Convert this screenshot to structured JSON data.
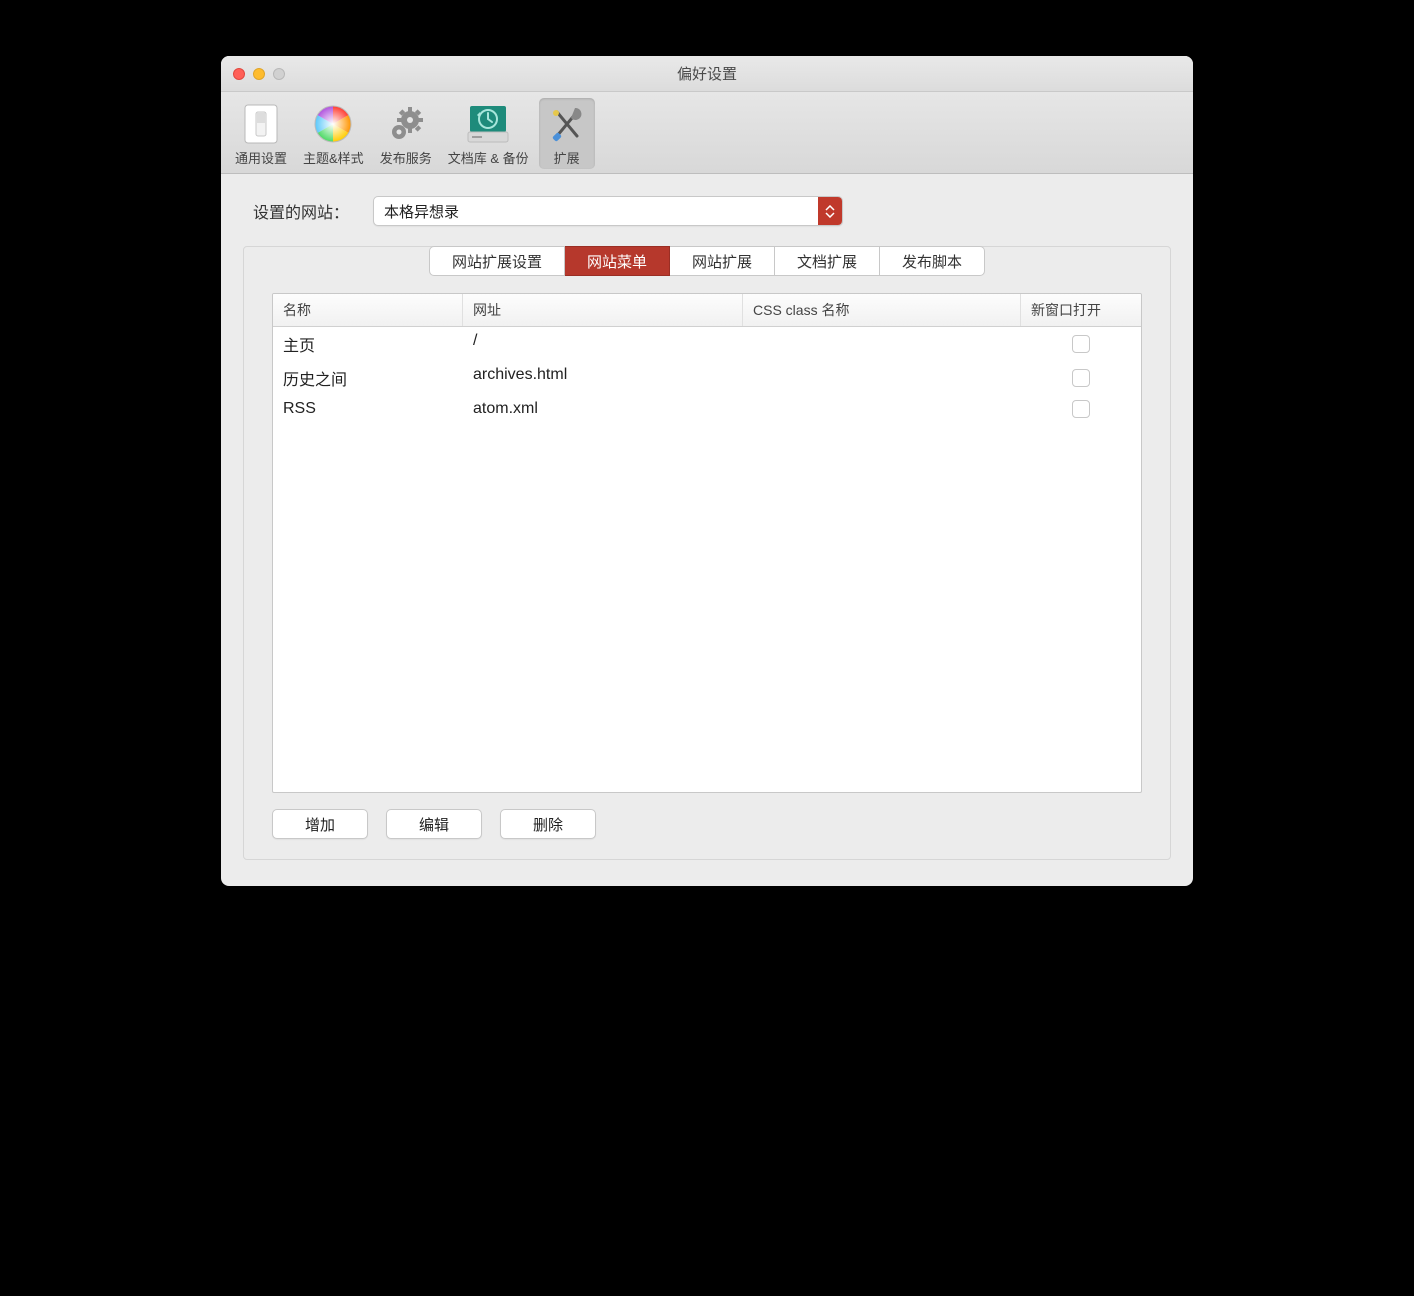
{
  "window": {
    "title": "偏好设置"
  },
  "toolbar": {
    "items": [
      {
        "id": "general",
        "label": "通用设置"
      },
      {
        "id": "theme",
        "label": "主题&样式"
      },
      {
        "id": "publish",
        "label": "发布服务"
      },
      {
        "id": "backup",
        "label": "文档库 & 备份"
      },
      {
        "id": "ext",
        "label": "扩展"
      }
    ],
    "active": "ext"
  },
  "site_select": {
    "label": "设置的网站：",
    "value": "本格异想录"
  },
  "tabs": {
    "items": [
      {
        "id": "ext-settings",
        "label": "网站扩展设置"
      },
      {
        "id": "menu",
        "label": "网站菜单"
      },
      {
        "id": "site-ext",
        "label": "网站扩展"
      },
      {
        "id": "doc-ext",
        "label": "文档扩展"
      },
      {
        "id": "script",
        "label": "发布脚本"
      }
    ],
    "active": "menu"
  },
  "table": {
    "headers": {
      "name": "名称",
      "url": "网址",
      "css": "CSS class 名称",
      "newwin": "新窗口打开"
    },
    "rows": [
      {
        "name": "主页",
        "url": "/",
        "css": "",
        "newwin": false
      },
      {
        "name": "历史之间",
        "url": "archives.html",
        "css": "",
        "newwin": false
      },
      {
        "name": "RSS",
        "url": "atom.xml",
        "css": "",
        "newwin": false
      }
    ]
  },
  "buttons": {
    "add": "增加",
    "edit": "编辑",
    "delete": "删除"
  }
}
